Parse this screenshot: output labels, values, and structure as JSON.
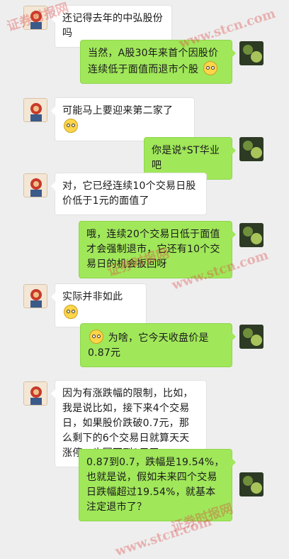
{
  "messages": [
    {
      "side": "left",
      "text": "还记得去年的中弘股份吗"
    },
    {
      "side": "right",
      "text": "当然，A股30年来首个因股价连续低于面值而退市个股",
      "emoji_end": "smirk-emoji-icon"
    },
    {
      "side": "left",
      "text": "可能马上要迎来第二家了",
      "emoji_end": "wide-eyed-emoji-icon"
    },
    {
      "side": "right",
      "text": "你是说*ST华业吧"
    },
    {
      "side": "left",
      "text": "对，它已经连续10个交易日股价低于1元的面值了"
    },
    {
      "side": "right",
      "text": "哦，连续20个交易日低于面值才会强制退市，它还有10个交易日的机会扳回呀"
    },
    {
      "side": "left",
      "text": "实际并非如此",
      "emoji_end": "smile-emoji-icon"
    },
    {
      "side": "right",
      "text": "为啥，它今天收盘价是0.87元",
      "emoji_start": "wide-eyed-emoji-icon"
    },
    {
      "side": "left",
      "text": "因为有涨跌幅的限制，比如，我是说比如，接下来4个交易日，如果股价跌破0.7元，那么剩下的6个交易日就算天天涨停，也回不到1元了"
    },
    {
      "side": "right",
      "text": "0.87到0.7，跌幅是19.54%，也就是说，假如未来四个交易日跌幅超过19.54%，就基本注定退市了？"
    }
  ],
  "watermarks": [
    "证券时报网",
    "www.stcn.com",
    "证券时报网",
    "www.stcn.com",
    "证券时报网",
    "www.stcn.com"
  ],
  "colors": {
    "right_bubble": "#a0e75a",
    "left_bubble": "#ffffff",
    "background": "#eeeeee",
    "watermark": "#dc3c3c"
  }
}
